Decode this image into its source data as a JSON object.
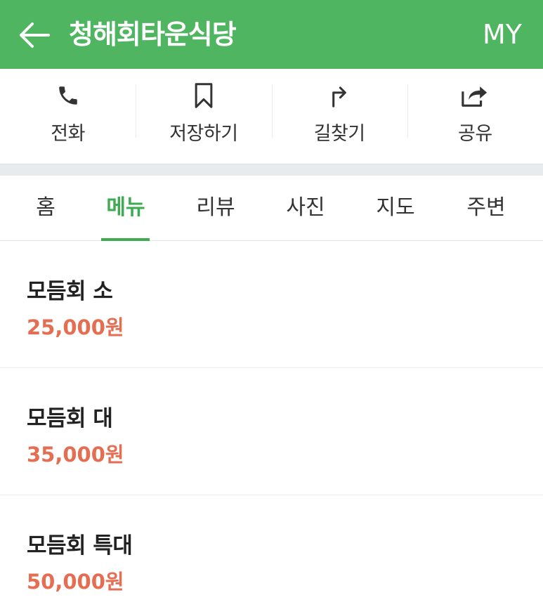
{
  "header": {
    "title": "청해회타운식당",
    "my_label": "MY",
    "background_color": "#4fb561"
  },
  "actions": [
    {
      "label": "전화",
      "icon": "phone-icon"
    },
    {
      "label": "저장하기",
      "icon": "bookmark-icon"
    },
    {
      "label": "길찾기",
      "icon": "directions-icon"
    },
    {
      "label": "공유",
      "icon": "share-icon"
    }
  ],
  "tabs": [
    {
      "label": "홈"
    },
    {
      "label": "메뉴"
    },
    {
      "label": "리뷰"
    },
    {
      "label": "사진"
    },
    {
      "label": "지도"
    },
    {
      "label": "주변"
    }
  ],
  "active_tab": "메뉴",
  "accent_color": "#3dab4f",
  "price_color": "#e56e52",
  "menu": [
    {
      "name": "모듬회 소",
      "price": "25,000원"
    },
    {
      "name": "모듬회 대",
      "price": "35,000원"
    },
    {
      "name": "모듬회 특대",
      "price": "50,000원"
    }
  ]
}
